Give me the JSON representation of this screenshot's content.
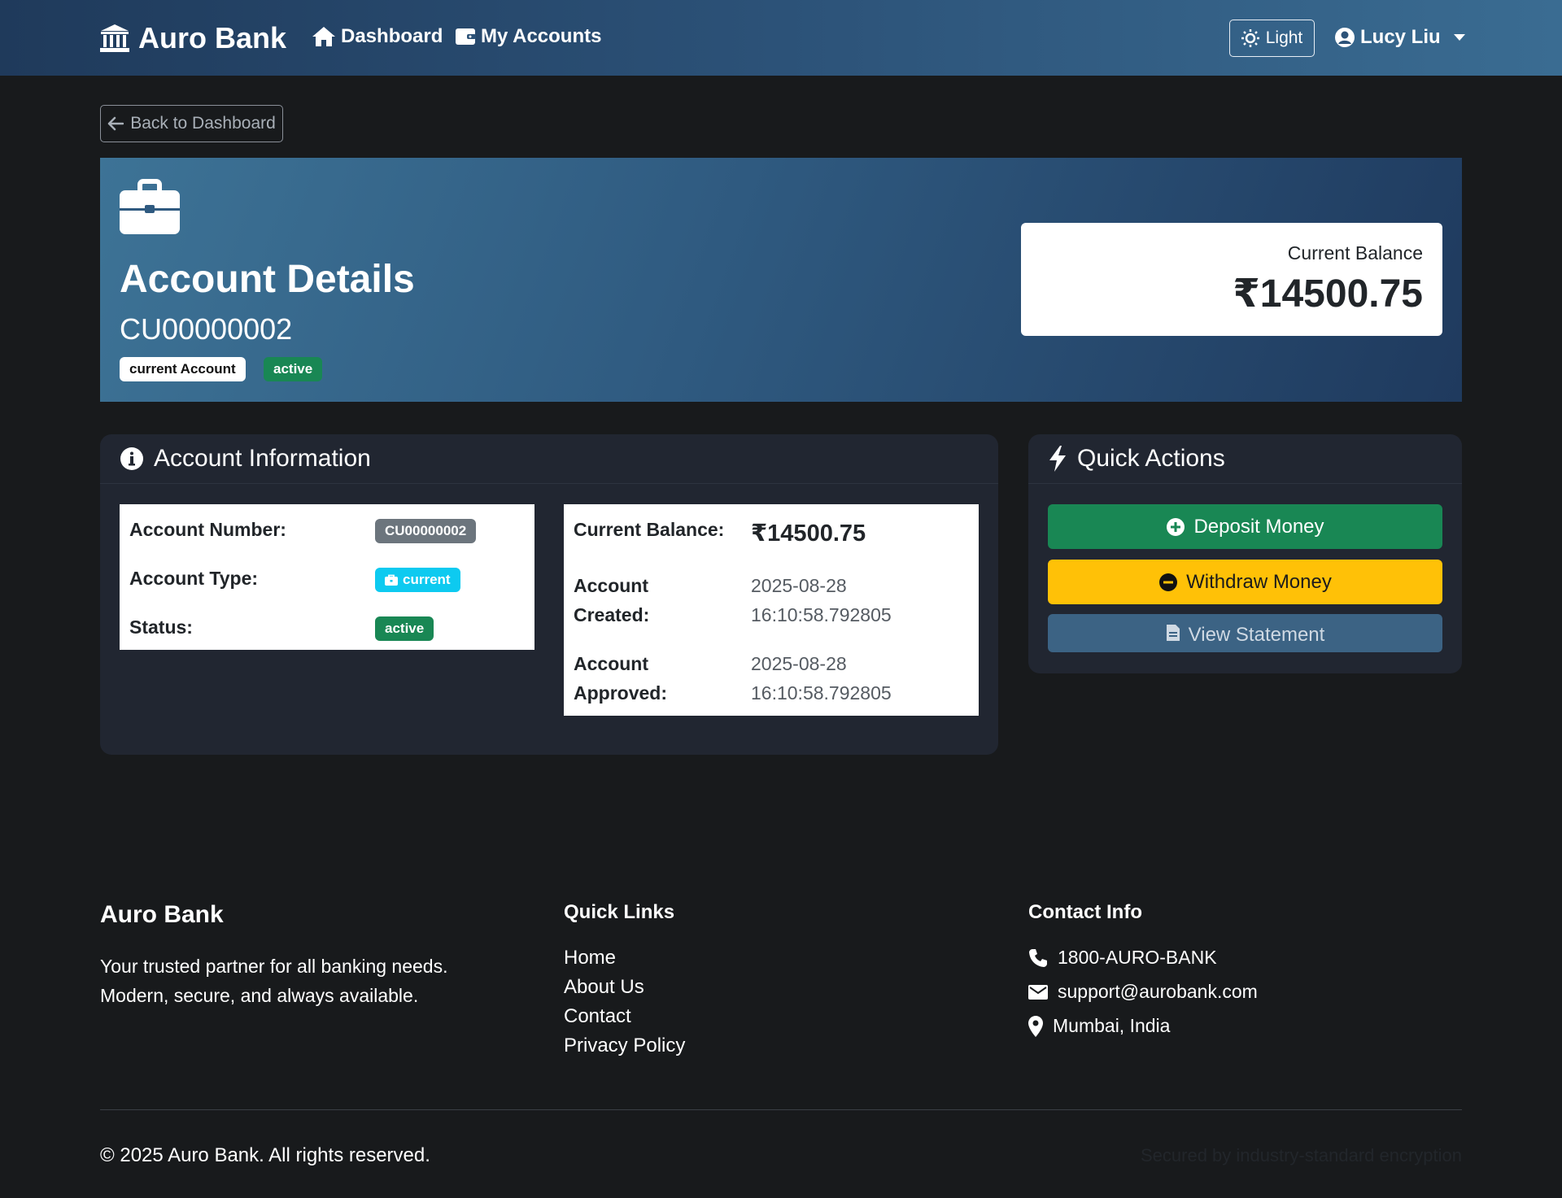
{
  "navbar": {
    "brand": "Auro Bank",
    "links": [
      "Dashboard",
      "My Accounts"
    ],
    "theme_toggle": "Light",
    "user_name": "Lucy Liu",
    "icons": {
      "brand": "bank-icon",
      "dashboard": "home-icon",
      "accounts": "wallet-icon",
      "theme": "sun-icon",
      "user": "user-circle-icon"
    }
  },
  "back_button": "Back to Dashboard",
  "hero": {
    "title": "Account Details",
    "account_number": "CU00000002",
    "type_badge": "current Account",
    "status_badge": "active",
    "balance_label": "Current Balance",
    "balance_value": "₹14500.75",
    "icon": "briefcase-icon"
  },
  "account_info": {
    "header": "Account Information",
    "left": {
      "number_label": "Account Number:",
      "number_value": "CU00000002",
      "type_label": "Account Type:",
      "type_value": "current",
      "status_label": "Status:",
      "status_value": "active"
    },
    "right": {
      "balance_label": "Current Balance:",
      "balance_value": "₹14500.75",
      "created_label_1": "Account",
      "created_label_2": "Created:",
      "created_date": "2025-08-28",
      "created_time": "16:10:58.792805",
      "approved_label_1": "Account",
      "approved_label_2": "Approved:",
      "approved_date": "2025-08-28",
      "approved_time": "16:10:58.792805"
    }
  },
  "quick_actions": {
    "header": "Quick Actions",
    "deposit": "Deposit Money",
    "withdraw": "Withdraw Money",
    "statement": "View Statement"
  },
  "footer": {
    "brand": "Auro Bank",
    "tagline_1": "Your trusted partner for all banking needs.",
    "tagline_2": "Modern, secure, and always available.",
    "quick_links_title": "Quick Links",
    "quick_links": [
      "Home",
      "About Us",
      "Contact",
      "Privacy Policy"
    ],
    "contact_title": "Contact Info",
    "phone": "1800-AURO-BANK",
    "email": "support@aurobank.com",
    "location": "Mumbai, India",
    "copyright": "© 2025 Auro Bank. All rights reserved.",
    "security_note": "Secured by industry-standard encryption"
  },
  "colors": {
    "success": "#198754",
    "warning": "#ffc107",
    "info": "#0dcaf0",
    "secondary": "#6c757d",
    "statement_btn": "#3c6384"
  }
}
